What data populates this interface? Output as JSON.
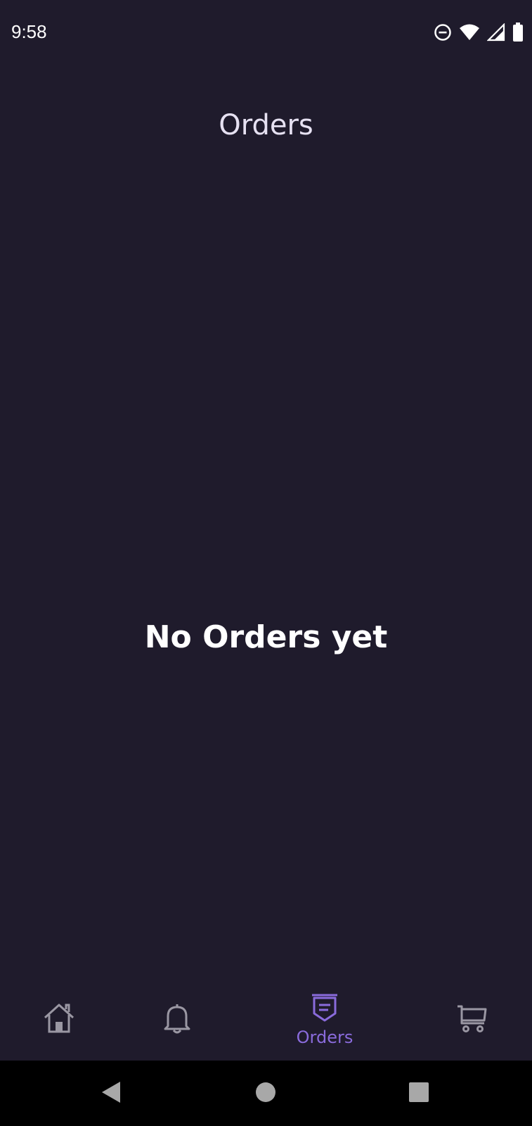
{
  "status_bar": {
    "time": "9:58",
    "icons": [
      "do-not-disturb-icon",
      "wifi-icon",
      "cell-signal-icon",
      "battery-icon"
    ]
  },
  "header": {
    "title": "Orders"
  },
  "main": {
    "empty_message": "No Orders yet"
  },
  "bottom_nav": {
    "items": [
      {
        "icon": "home-icon",
        "label": "",
        "active": false
      },
      {
        "icon": "bell-icon",
        "label": "",
        "active": false
      },
      {
        "icon": "orders-icon",
        "label": "Orders",
        "active": true
      },
      {
        "icon": "cart-icon",
        "label": "",
        "active": false
      }
    ]
  },
  "android_nav": {
    "buttons": [
      "back-icon",
      "home-circle-icon",
      "recents-icon"
    ]
  },
  "colors": {
    "background": "#1f1b2c",
    "accent": "#8a6bdc",
    "inactive_icon": "#9a97a3",
    "title_text": "#e6e1f2"
  }
}
